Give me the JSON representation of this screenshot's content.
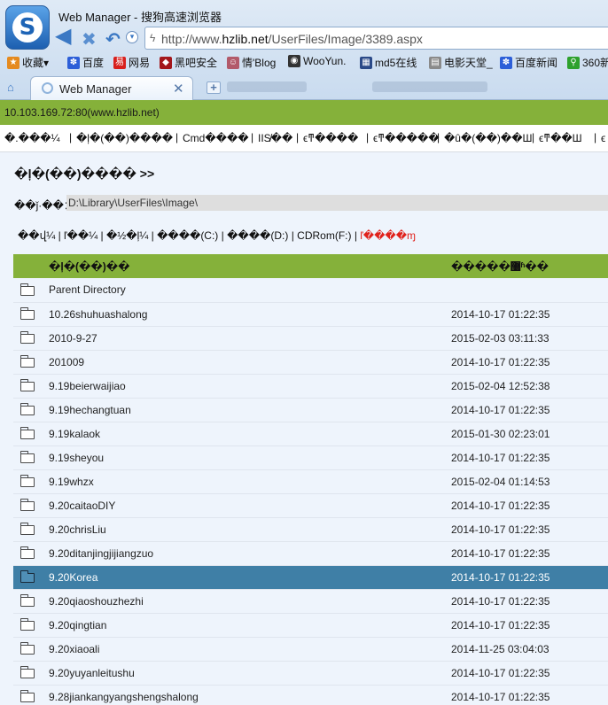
{
  "browser": {
    "logo_letter": "S",
    "window_title": "Web Manager - 搜狗高速浏览器",
    "url_prefix": "http://www.",
    "url_domain": "hzlib.net",
    "url_path": "/UserFiles/Image/3389.aspx",
    "bookmarks": [
      "收藏▾",
      "百度",
      "网易",
      "黑吧安全",
      "情'Blog",
      "WooYun.",
      "md5在线",
      "电影天堂_",
      "百度新闻",
      "360新"
    ],
    "tab_title": "Web Manager",
    "tab_close": "✕",
    "new_tab": "+"
  },
  "server_bar": {
    "text": "10.103.169.72:80(www.hzlib.net)"
  },
  "menu": {
    "items": [
      "�.���¼",
      "�ļ�(��)����",
      "Cmd����",
      "IIS̸��",
      "ϵͳ����",
      "ϵͳ�����",
      "�û�(��)��Ш",
      "ϵͳ��Ш",
      "ϵ"
    ],
    "separator": "|"
  },
  "main": {
    "section_title": "�ļ�(��)���� >>",
    "path_label": "��ǰ·��：",
    "path_value": "D:\\Library\\UserFiles\\Image\\",
    "drives": [
      "��վ¼",
      "ľ��¼",
      "�½�ļ¼",
      "����(C:)",
      "����(D:)",
      "CDRom(F:)",
      "ľ����ɱ"
    ],
    "drive_separator": "|",
    "col_name": "�ļ�(��)��",
    "col_time": "�����޸ʱ��"
  },
  "files": [
    {
      "name": "Parent Directory",
      "time": ""
    },
    {
      "name": "10.26shuhuashalong",
      "time": "2014-10-17 01:22:35"
    },
    {
      "name": "2010-9-27",
      "time": "2015-02-03 03:11:33"
    },
    {
      "name": "201009",
      "time": "2014-10-17 01:22:35"
    },
    {
      "name": "9.19beierwaijiao",
      "time": "2015-02-04 12:52:38"
    },
    {
      "name": "9.19hechangtuan",
      "time": "2014-10-17 01:22:35"
    },
    {
      "name": "9.19kalaok",
      "time": "2015-01-30 02:23:01"
    },
    {
      "name": "9.19sheyou",
      "time": "2014-10-17 01:22:35"
    },
    {
      "name": "9.19whzx",
      "time": "2015-02-04 01:14:53"
    },
    {
      "name": "9.20caitaoDIY",
      "time": "2014-10-17 01:22:35"
    },
    {
      "name": "9.20chrisLiu",
      "time": "2014-10-17 01:22:35"
    },
    {
      "name": "9.20ditanjingjijiangzuo",
      "time": "2014-10-17 01:22:35"
    },
    {
      "name": "9.20Korea",
      "time": "2014-10-17 01:22:35"
    },
    {
      "name": "9.20qiaoshouzhezhi",
      "time": "2014-10-17 01:22:35"
    },
    {
      "name": "9.20qingtian",
      "time": "2014-10-17 01:22:35"
    },
    {
      "name": "9.20xiaoali",
      "time": "2014-11-25 03:04:03"
    },
    {
      "name": "9.20yuyanleitushu",
      "time": "2014-10-17 01:22:35"
    },
    {
      "name": "9.28jiankangyangshengshalong",
      "time": "2014-10-17 01:22:35"
    }
  ],
  "selected_file": "9.20Korea",
  "colors": {
    "accent_green": "#85b13a",
    "selected_row": "#3f7fa6",
    "content_bg": "#eef4fc",
    "drive_red": "#e0211b"
  }
}
